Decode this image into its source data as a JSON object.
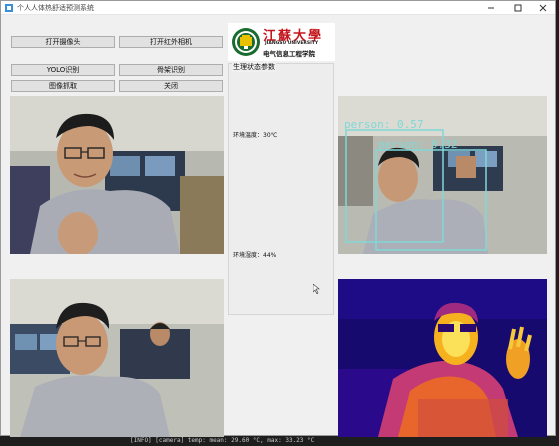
{
  "window": {
    "title": "个人人体热舒适预测系统"
  },
  "buttons": {
    "open_camera": "打开摄像头",
    "open_ir_camera": "打开红外相机",
    "yolo_detect": "YOLO识别",
    "skeleton_detect": "骨架识别",
    "image_capture": "图像抓取",
    "close": "关闭"
  },
  "logo": {
    "name_cn": "江蘇大學",
    "name_en": "JIANGSU UNIVERSITY",
    "school": "电气信息工程学院"
  },
  "status": {
    "title": "生理状态参数",
    "temperature": "环境温度：30℃",
    "humidity": "环境湿度：44%"
  },
  "detections": [
    {
      "label": "person: 0.57"
    },
    {
      "label": "person: 0.32"
    }
  ],
  "terminal": {
    "line": "[INFO] [camera] temp: mean: 29.60 °C, max: 33.23 °C"
  },
  "colors": {
    "button_bg": "#e1e1e1",
    "detection_box": "#7fd8d8",
    "logo_red": "#c4161c",
    "logo_green": "#1a6b2f"
  },
  "icons": {
    "minimize": "minimize-icon",
    "maximize": "maximize-icon",
    "close": "close-icon"
  }
}
